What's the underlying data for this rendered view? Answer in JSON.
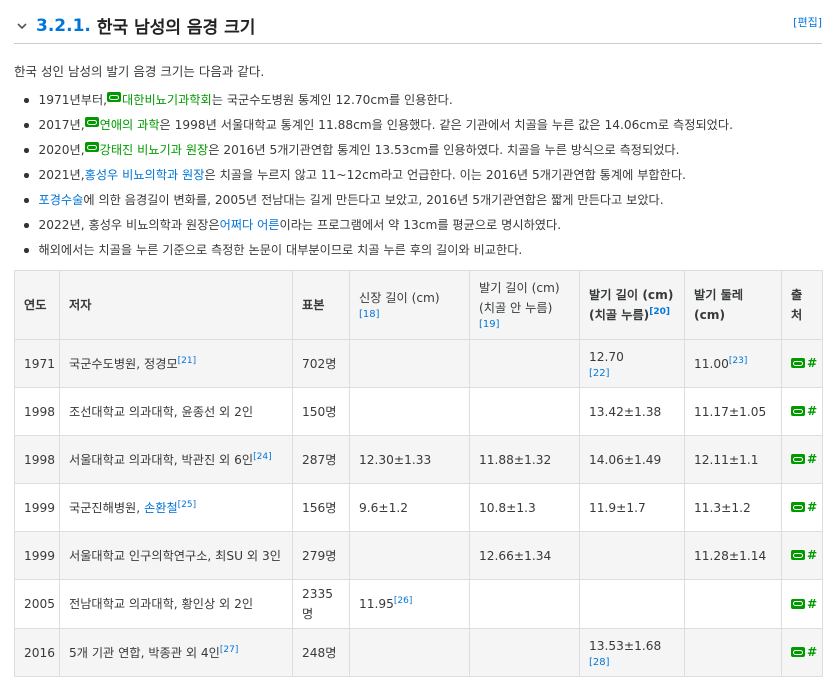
{
  "section": {
    "number": "3.2.1.",
    "title": "한국 남성의 음경 크기",
    "edit_label": "[편집]"
  },
  "intro": "한국 성인 남성의 발기 음경 크기는 다음과 같다.",
  "bullets": [
    {
      "pre": "1971년부터, ",
      "link": "대한비뇨기과학회",
      "link_icon": "link-icon",
      "post": "는 국군수도병원 통계인 12.70cm를 인용한다."
    },
    {
      "pre": "2017년, ",
      "link": "연애의 과학",
      "link_icon": "link-icon",
      "post": "은 1998년 서울대학교 통계인 11.88cm을 인용했다. 같은 기관에서 치골을 누른 값은 14.06cm로 측정되었다."
    },
    {
      "pre": "2020년, ",
      "link": "강태진 비뇨기과 원장",
      "link_icon": "link-icon",
      "post": "은 2016년 5개기관연합 통계인 13.53cm를 인용하였다. 치골을 누른 방식으로 측정되었다."
    },
    {
      "pre": "2021년, ",
      "link": "홍성우 비뇨의학과 원장",
      "post": "은 치골을 누르지 않고 11~12cm라고 언급한다. 이는 2016년 5개기관연합 통계에 부합한다."
    },
    {
      "pre": "",
      "link": "포경수술",
      "post": "에 의한 음경길이 변화를, 2005년 전남대는 길게 만든다고 보았고, 2016년 5개기관연합은 짧게 만든다고 보았다."
    },
    {
      "pre": "2022년, 홍성우 비뇨의학과 원장은 ",
      "link": "어쩌다 어른",
      "post": "이라는 프로그램에서 약 13cm를 평균으로 명시하였다."
    },
    {
      "pre": "해외에서는 치골을 누른 기준으로 측정한 논문이 대부분이므로 치골 누른 후의 길이와 비교한다.",
      "link": "",
      "post": ""
    }
  ],
  "table": {
    "headers": {
      "year": "연도",
      "author": "저자",
      "sample": "표본",
      "stretch": "신장 길이 (cm)",
      "stretch_ref": "[18]",
      "erect_nopress_1": "발기 길이 (cm)",
      "erect_nopress_2": "(치골 안 누름)",
      "erect_nopress_ref": "[19]",
      "erect_press_1": "발기 길이 (cm)",
      "erect_press_2": "(치골 누름)",
      "erect_press_ref": "[20]",
      "girth": "발기 둘레 (cm)",
      "source": "출처"
    },
    "rows": [
      {
        "year": "1971",
        "author": "국군수도병원, 정경모",
        "author_ref": "[21]",
        "sample": "702명",
        "stretch": "",
        "stretch_ref": "",
        "nopress": "",
        "press": "12.70",
        "press_ref": "[22]",
        "girth": "11.00",
        "girth_ref": "[23]",
        "source": "#"
      },
      {
        "year": "1998",
        "author": "조선대학교 의과대학, 윤종선 외 2인",
        "author_ref": "",
        "sample": "150명",
        "stretch": "",
        "stretch_ref": "",
        "nopress": "",
        "press": "13.42±1.38",
        "press_ref": "",
        "girth": "11.17±1.05",
        "girth_ref": "",
        "source": "#"
      },
      {
        "year": "1998",
        "author": "서울대학교 의과대학, 박관진 외 6인",
        "author_ref": "[24]",
        "sample": "287명",
        "stretch": "12.30±1.33",
        "stretch_ref": "",
        "nopress": "11.88±1.32",
        "press": "14.06±1.49",
        "press_ref": "",
        "girth": "12.11±1.1",
        "girth_ref": "",
        "source": "#"
      },
      {
        "year": "1999",
        "author": "국군진해병원, ",
        "author_link": "손환철",
        "author_ref": "[25]",
        "sample": "156명",
        "stretch": "9.6±1.2",
        "stretch_ref": "",
        "nopress": "10.8±1.3",
        "press": "11.9±1.7",
        "press_ref": "",
        "girth": "11.3±1.2",
        "girth_ref": "",
        "source": "#"
      },
      {
        "year": "1999",
        "author": "서울대학교 인구의학연구소, 최SU 외 3인",
        "author_ref": "",
        "sample": "279명",
        "stretch": "",
        "stretch_ref": "",
        "nopress": "12.66±1.34",
        "press": "",
        "press_ref": "",
        "girth": "11.28±1.14",
        "girth_ref": "",
        "source": "#"
      },
      {
        "year": "2005",
        "author": "전남대학교 의과대학, 황인상 외 2인",
        "author_ref": "",
        "sample": "2335명",
        "stretch": "11.95",
        "stretch_ref": "[26]",
        "nopress": "",
        "press": "",
        "press_ref": "",
        "girth": "",
        "girth_ref": "",
        "source": "#"
      },
      {
        "year": "2016",
        "author": "5개 기관 연합, 박종관 외 4인",
        "author_ref": "[27]",
        "sample": "248명",
        "stretch": "",
        "stretch_ref": "",
        "nopress": "",
        "press": "13.53±1.68",
        "press_ref": "[28]",
        "girth": "",
        "girth_ref": "",
        "source": "#"
      }
    ]
  }
}
